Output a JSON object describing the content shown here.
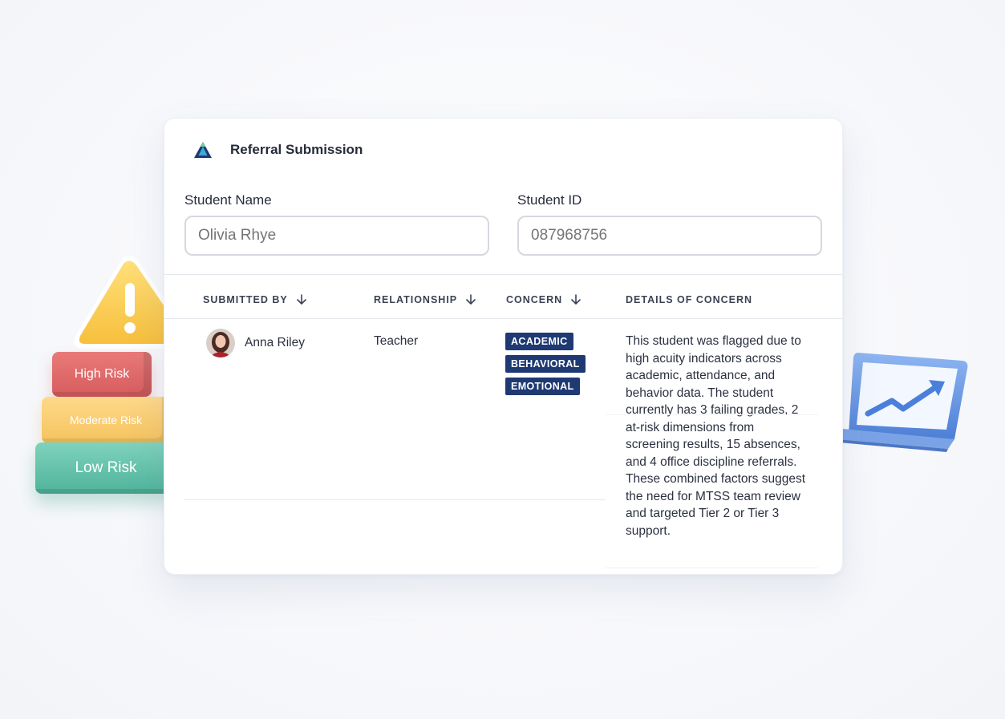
{
  "decor": {
    "high_risk_label": "High Risk",
    "moderate_risk_label": "Moderate Risk",
    "low_risk_label": "Low Risk"
  },
  "header": {
    "title": "Referral Submission",
    "logo_icon": "triangle-logo-icon"
  },
  "form": {
    "student_name_label": "Student Name",
    "student_name_placeholder": "Olivia Rhye",
    "student_id_label": "Student ID",
    "student_id_placeholder": "087968756"
  },
  "table": {
    "columns": [
      "SUBMITTED BY",
      "RELATIONSHIP",
      "CONCERN",
      "DETAILS OF CONCERN"
    ],
    "rows": [
      {
        "submitted_by": "Anna Riley",
        "relationship": "Teacher",
        "concerns": [
          "ACADEMIC",
          "BEHAVIORAL",
          "EMOTIONAL"
        ],
        "details": "This student was flagged due to high acuity indicators across academic, attendance, and behavior data. The student currently has 3 failing grades, 2 at-risk dimensions from screening results, 15 absences, and 4 office discipline referrals. These combined factors suggest the need for MTSS team review and targeted Tier 2 or Tier 3 support."
      }
    ]
  },
  "colors": {
    "tag_bg": "#1f3a73",
    "high_risk": "#e06a6a",
    "moderate_risk": "#f8cc6e",
    "low_risk": "#5fc0a6",
    "warning": "#ffd45a"
  }
}
